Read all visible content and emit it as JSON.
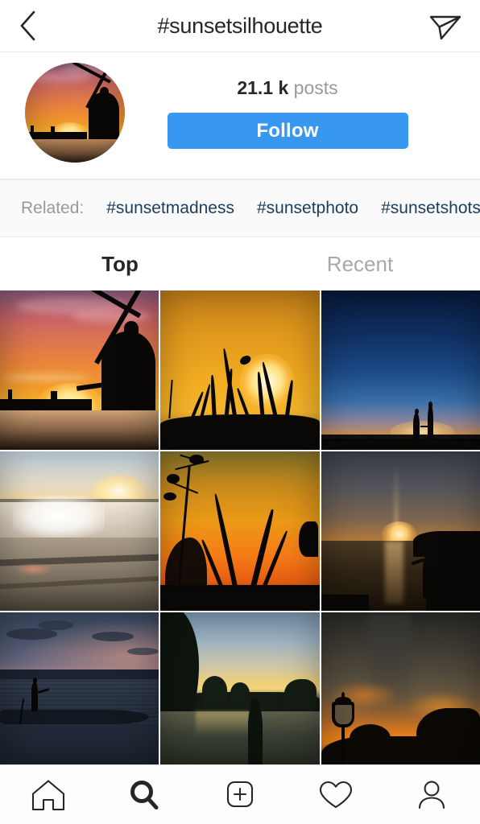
{
  "header": {
    "back_icon": "chevron-left-icon",
    "title": "#sunsetsilhouette",
    "share_icon": "paper-plane-icon"
  },
  "profile": {
    "avatar_alt": "windmill-sunset-silhouette",
    "post_count_value": "21.1 k",
    "post_count_label": "posts",
    "follow_label": "Follow",
    "follow_color": "#3897f0"
  },
  "related": {
    "label": "Related:",
    "tags": [
      "#sunsetmadness",
      "#sunsetphoto",
      "#sunsetshots"
    ],
    "tag_color": "#1c3c5c",
    "background": "#fafafa"
  },
  "tabs": [
    {
      "label": "Top",
      "active": true
    },
    {
      "label": "Recent",
      "active": false
    }
  ],
  "grid": {
    "columns": 3,
    "posts": [
      {
        "id": 1,
        "alt": "windmill silhouette against orange sunset over water"
      },
      {
        "id": 2,
        "alt": "bright sun behind wheat grass silhouettes in golden sky"
      },
      {
        "id": 3,
        "alt": "couple silhouetted on horizon under deep blue twilight sky"
      },
      {
        "id": 4,
        "alt": "waves crashing on beach with sun low on horizon"
      },
      {
        "id": 5,
        "alt": "tall plant and grass silhouettes against orange sunset"
      },
      {
        "id": 6,
        "alt": "person with arms raised silhouetted by sun setting over sea"
      },
      {
        "id": 7,
        "alt": "fisherman standing in long canoe on dusky lake"
      },
      {
        "id": 8,
        "alt": "person silhouetted at forest lake with yellow glow on horizon"
      },
      {
        "id": 9,
        "alt": "street lamp and trees silhouetted against stormy orange sunset"
      }
    ]
  },
  "navbar": {
    "items": [
      {
        "icon": "home-icon",
        "label": "Home",
        "active": false
      },
      {
        "icon": "search-icon",
        "label": "Search",
        "active": true
      },
      {
        "icon": "add-post-icon",
        "label": "New post",
        "active": false
      },
      {
        "icon": "heart-icon",
        "label": "Activity",
        "active": false
      },
      {
        "icon": "profile-icon",
        "label": "Profile",
        "active": false
      }
    ]
  }
}
